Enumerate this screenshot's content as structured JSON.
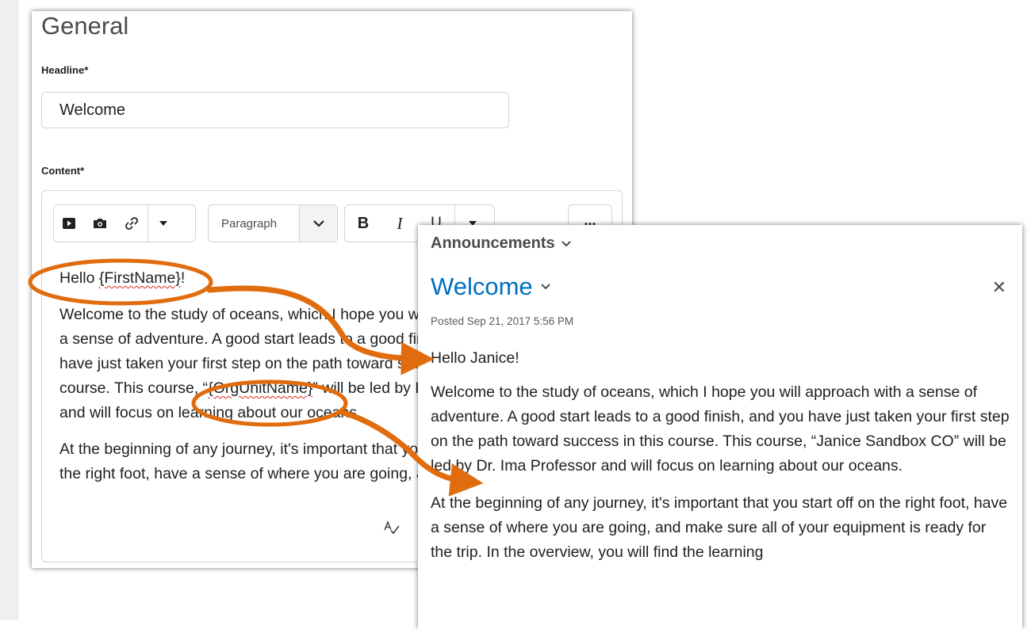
{
  "editor": {
    "section_title": "General",
    "headline_label": "Headline",
    "headline_value": "Welcome",
    "content_label": "Content",
    "required_marker": "*",
    "toolbar": {
      "video_icon": "play-icon",
      "image_icon": "camera-icon",
      "link_icon": "link-icon",
      "paragraph_select": "Paragraph",
      "bold": "B",
      "italic": "I",
      "underline": "U",
      "more": "..."
    },
    "content": {
      "line1_prefix": "Hello ",
      "line1_token": "{FirstName}",
      "line1_suffix": "!",
      "p2_line1": "Welcome to the study of oceans, which I hope you will approach with",
      "p2_line2": "a sense of adventure. A good start leads to a good finish, and you",
      "p2_line3": "have just taken your first step on the path toward success in this",
      "p2_line4_prefix": "course. This course, “",
      "p2_line4_token": "{OrgUnitName}",
      "p2_line4_suffix": "” will be led by Dr. Ima Professor",
      "p2_line5": "and will focus on learning about our oceans.",
      "p3_line1": "At the beginning of any journey, it's important that you start off on",
      "p3_line2": "the right foot, have a sense of where you are going, and make sure"
    }
  },
  "announcement": {
    "header": "Announcements",
    "title": "Welcome",
    "posted": "Posted Sep 21, 2017 5:56 PM",
    "greeting": "Hello Janice!",
    "paragraph1": "Welcome to the study of oceans, which I hope you will approach with a sense of adventure. A good start leads to a good finish, and you have just taken your first step on the path toward success in this course. This course, “Janice Sandbox CO” will be led by Dr. Ima Professor and will focus on learning about our oceans.",
    "paragraph2": "At the beginning of any journey, it's important that you start off on the right foot, have a sense of where you are going, and make sure all of your equipment is ready for the trip. In the overview, you will find the learning"
  },
  "colors": {
    "annotation": "#e06c0e",
    "link_title": "#006fbf",
    "border": "#cdd5dc"
  }
}
